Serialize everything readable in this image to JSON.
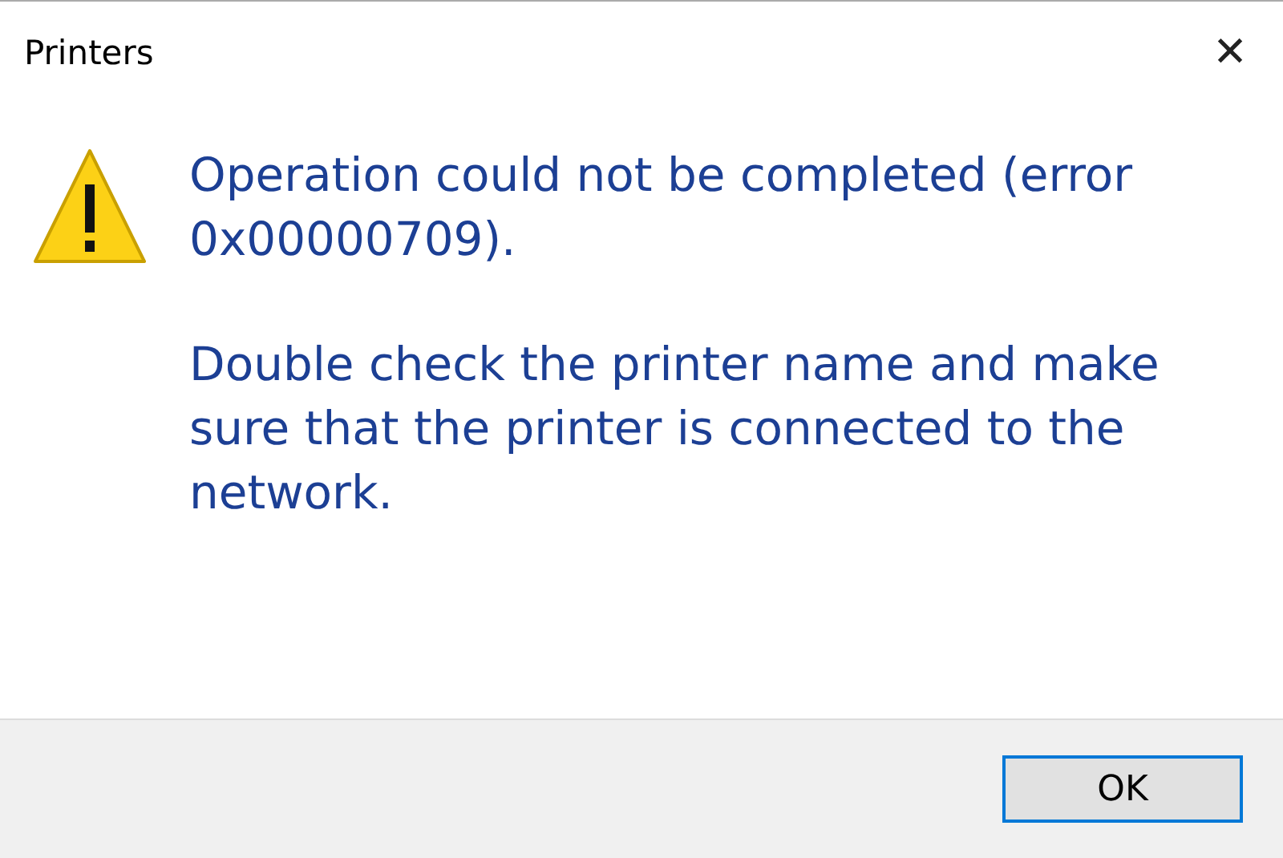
{
  "window": {
    "title": "Printers",
    "close": "✕"
  },
  "message": {
    "paragraphs": [
      "Operation could not be completed (error 0x00000709).",
      "Double check the printer name and make sure that the printer is connected to the network."
    ]
  },
  "buttons": [
    {
      "label": "OK",
      "selected": true
    }
  ]
}
